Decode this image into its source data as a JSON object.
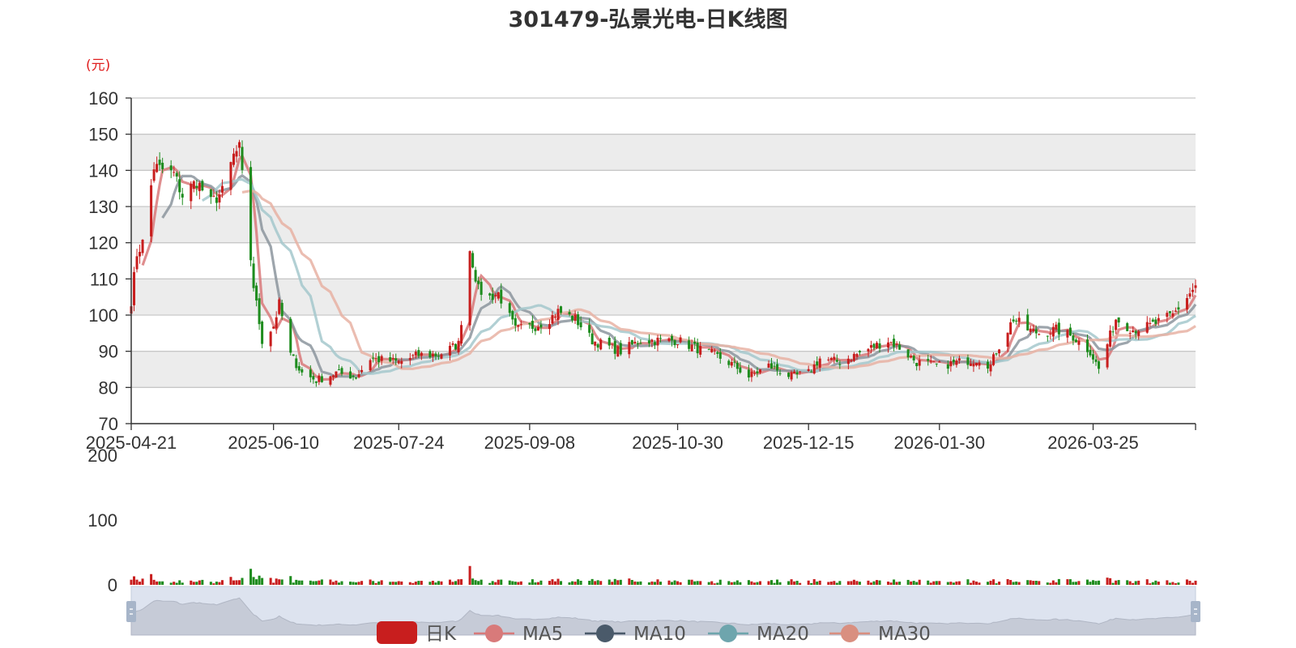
{
  "chart_data": {
    "type": "candlestick",
    "title": "301479-弘景光电-日K线图",
    "unit_label": "(元)",
    "price_axis": {
      "ylim": [
        70,
        160
      ],
      "ticks": [
        "70",
        "80",
        "90",
        "100",
        "110",
        "120",
        "130",
        "140",
        "150",
        "160"
      ]
    },
    "volume_axis": {
      "ylim": [
        0,
        200
      ],
      "ticks": [
        "0",
        "100",
        "200"
      ]
    },
    "x_axis": {
      "start": "2025-04-21",
      "end": "2026-04-30",
      "ticks": [
        "2025-04-21",
        "2025-06-10",
        "2025-07-24",
        "2025-09-08",
        "2025-10-30",
        "2025-12-15",
        "2026-01-30",
        "2026-03-25"
      ]
    },
    "grid": true,
    "colors": {
      "up": "#c81e1e",
      "down": "#1e8c1e",
      "ma5": "#d9797a",
      "ma10": "#8c959d",
      "ma20": "#a4c8cc",
      "ma30": "#e7b2a3"
    },
    "legend": {
      "position": "bottom",
      "items": [
        {
          "name": "日K",
          "color": "#c81e1e"
        },
        {
          "name": "MA5",
          "color": "#d87a7a"
        },
        {
          "name": "MA10",
          "color": "#4a5a6a"
        },
        {
          "name": "MA20",
          "color": "#6ea5ad"
        },
        {
          "name": "MA30",
          "color": "#d98f80"
        }
      ]
    },
    "close_keypoints": [
      [
        "2025-04-21",
        104
      ],
      [
        "2025-04-23",
        117
      ],
      [
        "2025-04-25",
        120
      ],
      [
        "2025-04-29",
        141
      ],
      [
        "2025-05-06",
        139
      ],
      [
        "2025-05-09",
        133
      ],
      [
        "2025-05-14",
        137
      ],
      [
        "2025-05-19",
        131
      ],
      [
        "2025-05-23",
        134
      ],
      [
        "2025-05-27",
        144
      ],
      [
        "2025-05-29",
        146
      ],
      [
        "2025-06-03",
        108
      ],
      [
        "2025-06-06",
        93
      ],
      [
        "2025-06-10",
        97
      ],
      [
        "2025-06-12",
        103
      ],
      [
        "2025-06-16",
        89
      ],
      [
        "2025-06-20",
        84
      ],
      [
        "2025-06-25",
        82
      ],
      [
        "2025-07-02",
        84
      ],
      [
        "2025-07-09",
        83
      ],
      [
        "2025-07-14",
        88
      ],
      [
        "2025-07-24",
        87
      ],
      [
        "2025-07-31",
        89
      ],
      [
        "2025-08-07",
        89
      ],
      [
        "2025-08-14",
        92
      ],
      [
        "2025-08-18",
        118
      ],
      [
        "2025-08-21",
        107
      ],
      [
        "2025-08-25",
        105
      ],
      [
        "2025-08-28",
        106
      ],
      [
        "2025-09-03",
        96
      ],
      [
        "2025-09-10",
        97
      ],
      [
        "2025-09-15",
        99
      ],
      [
        "2025-09-18",
        101
      ],
      [
        "2025-09-24",
        99
      ],
      [
        "2025-09-30",
        93
      ],
      [
        "2025-10-10",
        90
      ],
      [
        "2025-10-17",
        93
      ],
      [
        "2025-10-24",
        93
      ],
      [
        "2025-10-30",
        93
      ],
      [
        "2025-11-05",
        91
      ],
      [
        "2025-11-12",
        89
      ],
      [
        "2025-11-19",
        86
      ],
      [
        "2025-11-24",
        83
      ],
      [
        "2025-12-01",
        86
      ],
      [
        "2025-12-09",
        83
      ],
      [
        "2025-12-15",
        84
      ],
      [
        "2025-12-19",
        88
      ],
      [
        "2025-12-26",
        87
      ],
      [
        "2026-01-06",
        91
      ],
      [
        "2026-01-12",
        93
      ],
      [
        "2026-01-16",
        91
      ],
      [
        "2026-01-22",
        87
      ],
      [
        "2026-01-30",
        86
      ],
      [
        "2026-02-06",
        87
      ],
      [
        "2026-02-13",
        88
      ],
      [
        "2026-02-17",
        86
      ],
      [
        "2026-02-19",
        90
      ],
      [
        "2026-02-25",
        99
      ],
      [
        "2026-03-02",
        96
      ],
      [
        "2026-03-06",
        95
      ],
      [
        "2026-03-12",
        96
      ],
      [
        "2026-03-18",
        94
      ],
      [
        "2026-03-24",
        90
      ],
      [
        "2026-03-27",
        85
      ],
      [
        "2026-04-02",
        99
      ],
      [
        "2026-04-08",
        96
      ],
      [
        "2026-04-14",
        97
      ],
      [
        "2026-04-22",
        100
      ],
      [
        "2026-04-30",
        108
      ]
    ]
  }
}
